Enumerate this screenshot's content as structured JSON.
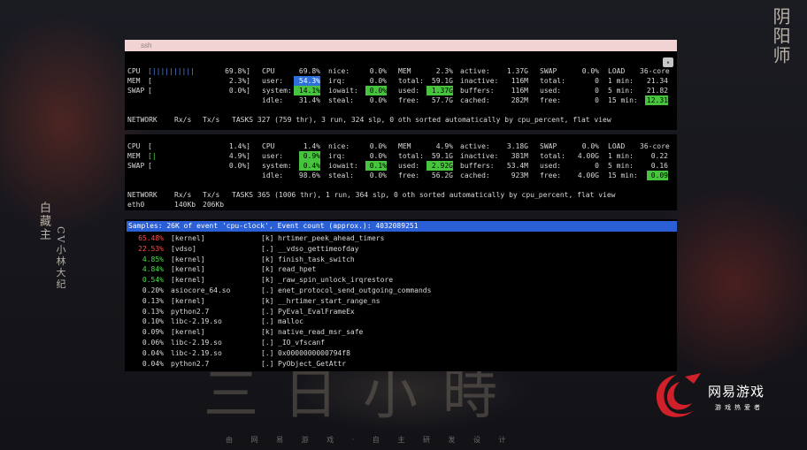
{
  "decor": {
    "top_right_title": "阴阳师",
    "left_vertical_1": "白藏主",
    "left_vertical_2": "CV小林大纪",
    "big_calligraphy": "三日小時",
    "tagline": "由 网 易 游 戏 · 自 主 研 发 设 计"
  },
  "brand": {
    "name": "网易游戏",
    "sub": "游戏热爱者",
    "color": "#d0202a"
  },
  "terminal1": {
    "window_title": "ssh",
    "cpu": {
      "label": "CPU",
      "bar": "[||||||||||",
      "pct": "69.8%]"
    },
    "mem": {
      "label": "MEM",
      "bar": "[",
      "pct": "2.3%]"
    },
    "swap": {
      "label": "SWAP",
      "bar": "[",
      "pct": "0.0%]"
    },
    "cpu_stats": {
      "title": "CPU",
      "total": "69.8%",
      "user_label": "user:",
      "user": "54.3%",
      "system_label": "system:",
      "system": "14.1%",
      "idle_label": "idle:",
      "idle": "31.4%",
      "nice_label": "nice:",
      "nice": "0.0%",
      "irq_label": "irq:",
      "irq": "0.0%",
      "iowait_label": "iowait:",
      "iowait": "0.0%",
      "steal_label": "steal:",
      "steal": "0.0%"
    },
    "mem_stats": {
      "title": "MEM",
      "pct": "2.3%",
      "total_label": "total:",
      "total": "59.1G",
      "used_label": "used:",
      "used": "1.37G",
      "free_label": "free:",
      "free": "57.7G",
      "active_label": "active:",
      "active": "1.37G",
      "inactive_label": "inactive:",
      "inactive": "116M",
      "buffers_label": "buffers:",
      "buffers": "116M",
      "cached_label": "cached:",
      "cached": "282M"
    },
    "swap_stats": {
      "title": "SWAP",
      "pct": "0.0%",
      "total_label": "total:",
      "total": "0",
      "used_label": "used:",
      "used": "0",
      "free_label": "free:",
      "free": "0"
    },
    "load": {
      "title": "LOAD",
      "cores": "36-core",
      "m1_label": "1 min:",
      "m1": "21.34",
      "m5_label": "5 min:",
      "m5": "21.82",
      "m15_label": "15 min:",
      "m15": "12.31"
    },
    "network": {
      "label": "NETWORK",
      "rx": "Rx/s",
      "tx": "Tx/s"
    },
    "tasks": "TASKS 327 (759 thr), 3 run, 324 slp, 0 oth sorted automatically by cpu_percent, flat view"
  },
  "terminal2": {
    "cpu": {
      "label": "CPU",
      "bar": "[",
      "pct": "1.4%]"
    },
    "mem": {
      "label": "MEM",
      "bar": "[|",
      "pct": "4.9%]"
    },
    "swap": {
      "label": "SWAP",
      "bar": "[",
      "pct": "0.0%]"
    },
    "cpu_stats": {
      "title": "CPU",
      "total": "1.4%",
      "user_label": "user:",
      "user": "0.9%",
      "system_label": "system:",
      "system": "0.4%",
      "idle_label": "idle:",
      "idle": "98.6%",
      "nice_label": "nice:",
      "nice": "0.0%",
      "irq_label": "irq:",
      "irq": "0.0%",
      "iowait_label": "iowait:",
      "iowait": "0.1%",
      "steal_label": "steal:",
      "steal": "0.0%"
    },
    "mem_stats": {
      "title": "MEM",
      "pct": "4.9%",
      "total_label": "total:",
      "total": "59.1G",
      "used_label": "used:",
      "used": "2.92G",
      "free_label": "free:",
      "free": "56.2G",
      "active_label": "active:",
      "active": "3.18G",
      "inactive_label": "inactive:",
      "inactive": "381M",
      "buffers_label": "buffers:",
      "buffers": "53.4M",
      "cached_label": "cached:",
      "cached": "923M"
    },
    "swap_stats": {
      "title": "SWAP",
      "pct": "0.0%",
      "total_label": "total:",
      "total": "4.00G",
      "used_label": "used:",
      "used": "0",
      "free_label": "free:",
      "free": "4.00G"
    },
    "load": {
      "title": "LOAD",
      "cores": "36-core",
      "m1_label": "1 min:",
      "m1": "0.22",
      "m5_label": "5 min:",
      "m5": "0.16",
      "m15_label": "15 min:",
      "m15": "0.09"
    },
    "network": {
      "label": "NETWORK",
      "rx": "Rx/s",
      "tx": "Tx/s",
      "iface": "eth0",
      "iface_rx": "140Kb",
      "iface_tx": "206Kb"
    },
    "tasks": "TASKS 365 (1006 thr), 1 run, 364 slp, 0 oth sorted automatically by cpu_percent, flat view"
  },
  "perf": {
    "header": "Samples: 26K of event 'cpu-clock', Event count (approx.): 4032089251",
    "rows": [
      {
        "pct": "65.48%",
        "dso": "[kernel]",
        "type": "[k]",
        "sym": "hrtimer_peek_ahead_timers",
        "color": "red"
      },
      {
        "pct": "22.53%",
        "dso": "[vdso]",
        "type": "[.]",
        "sym": "__vdso_gettimeofday",
        "color": "red"
      },
      {
        "pct": "4.85%",
        "dso": "[kernel]",
        "type": "[k]",
        "sym": "finish_task_switch",
        "color": "green"
      },
      {
        "pct": "4.84%",
        "dso": "[kernel]",
        "type": "[k]",
        "sym": "read_hpet",
        "color": "green"
      },
      {
        "pct": "0.54%",
        "dso": "[kernel]",
        "type": "[k]",
        "sym": "_raw_spin_unlock_irqrestore",
        "color": "green"
      },
      {
        "pct": "0.20%",
        "dso": "asiocore_64.so",
        "type": "[.]",
        "sym": "enet_protocol_send_outgoing_commands",
        "color": "white"
      },
      {
        "pct": "0.13%",
        "dso": "[kernel]",
        "type": "[k]",
        "sym": "__hrtimer_start_range_ns",
        "color": "white"
      },
      {
        "pct": "0.13%",
        "dso": "python2.7",
        "type": "[.]",
        "sym": "PyEval_EvalFrameEx",
        "color": "white"
      },
      {
        "pct": "0.10%",
        "dso": "libc-2.19.so",
        "type": "[.]",
        "sym": "malloc",
        "color": "white"
      },
      {
        "pct": "0.09%",
        "dso": "[kernel]",
        "type": "[k]",
        "sym": "native_read_msr_safe",
        "color": "white"
      },
      {
        "pct": "0.06%",
        "dso": "libc-2.19.so",
        "type": "[.]",
        "sym": "_IO_vfscanf",
        "color": "white"
      },
      {
        "pct": "0.04%",
        "dso": "libc-2.19.so",
        "type": "[.]",
        "sym": "0x0000000000794f8",
        "color": "white"
      },
      {
        "pct": "0.04%",
        "dso": "python2.7",
        "type": "[.]",
        "sym": "PyObject_GetAttr",
        "color": "white"
      }
    ]
  }
}
